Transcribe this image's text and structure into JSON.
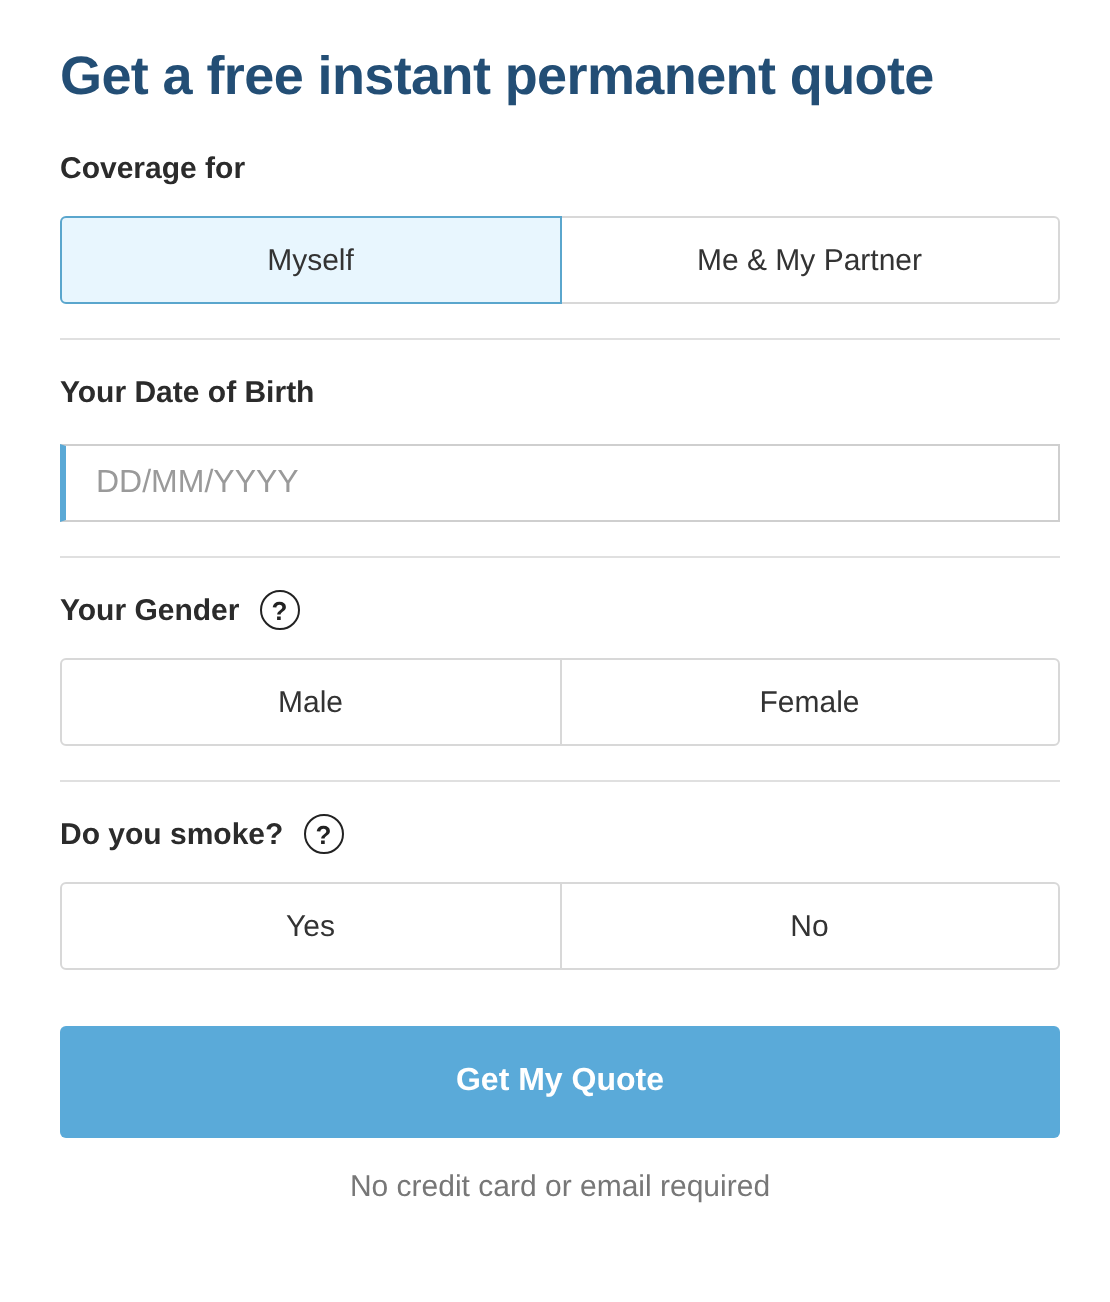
{
  "title": "Get a free instant permanent quote",
  "sections": [
    {
      "kind": "choice",
      "label": "Coverage for",
      "options": [
        {
          "label": "Myself",
          "selected": true
        },
        {
          "label": "Me & My Partner",
          "selected": false
        }
      ]
    },
    {
      "kind": "date",
      "label": "Your Date of Birth",
      "placeholder": "DD/MM/YYYY"
    },
    {
      "kind": "choice",
      "label": "Your Gender",
      "help": "?",
      "options": [
        {
          "label": "Male",
          "selected": false
        },
        {
          "label": "Female",
          "selected": false
        }
      ]
    },
    {
      "kind": "choice",
      "label": "Do you smoke?",
      "help": "?",
      "options": [
        {
          "label": "Yes",
          "selected": false
        },
        {
          "label": "No",
          "selected": false
        }
      ]
    }
  ],
  "submit": "Get My Quote",
  "note": "No credit card or email required"
}
